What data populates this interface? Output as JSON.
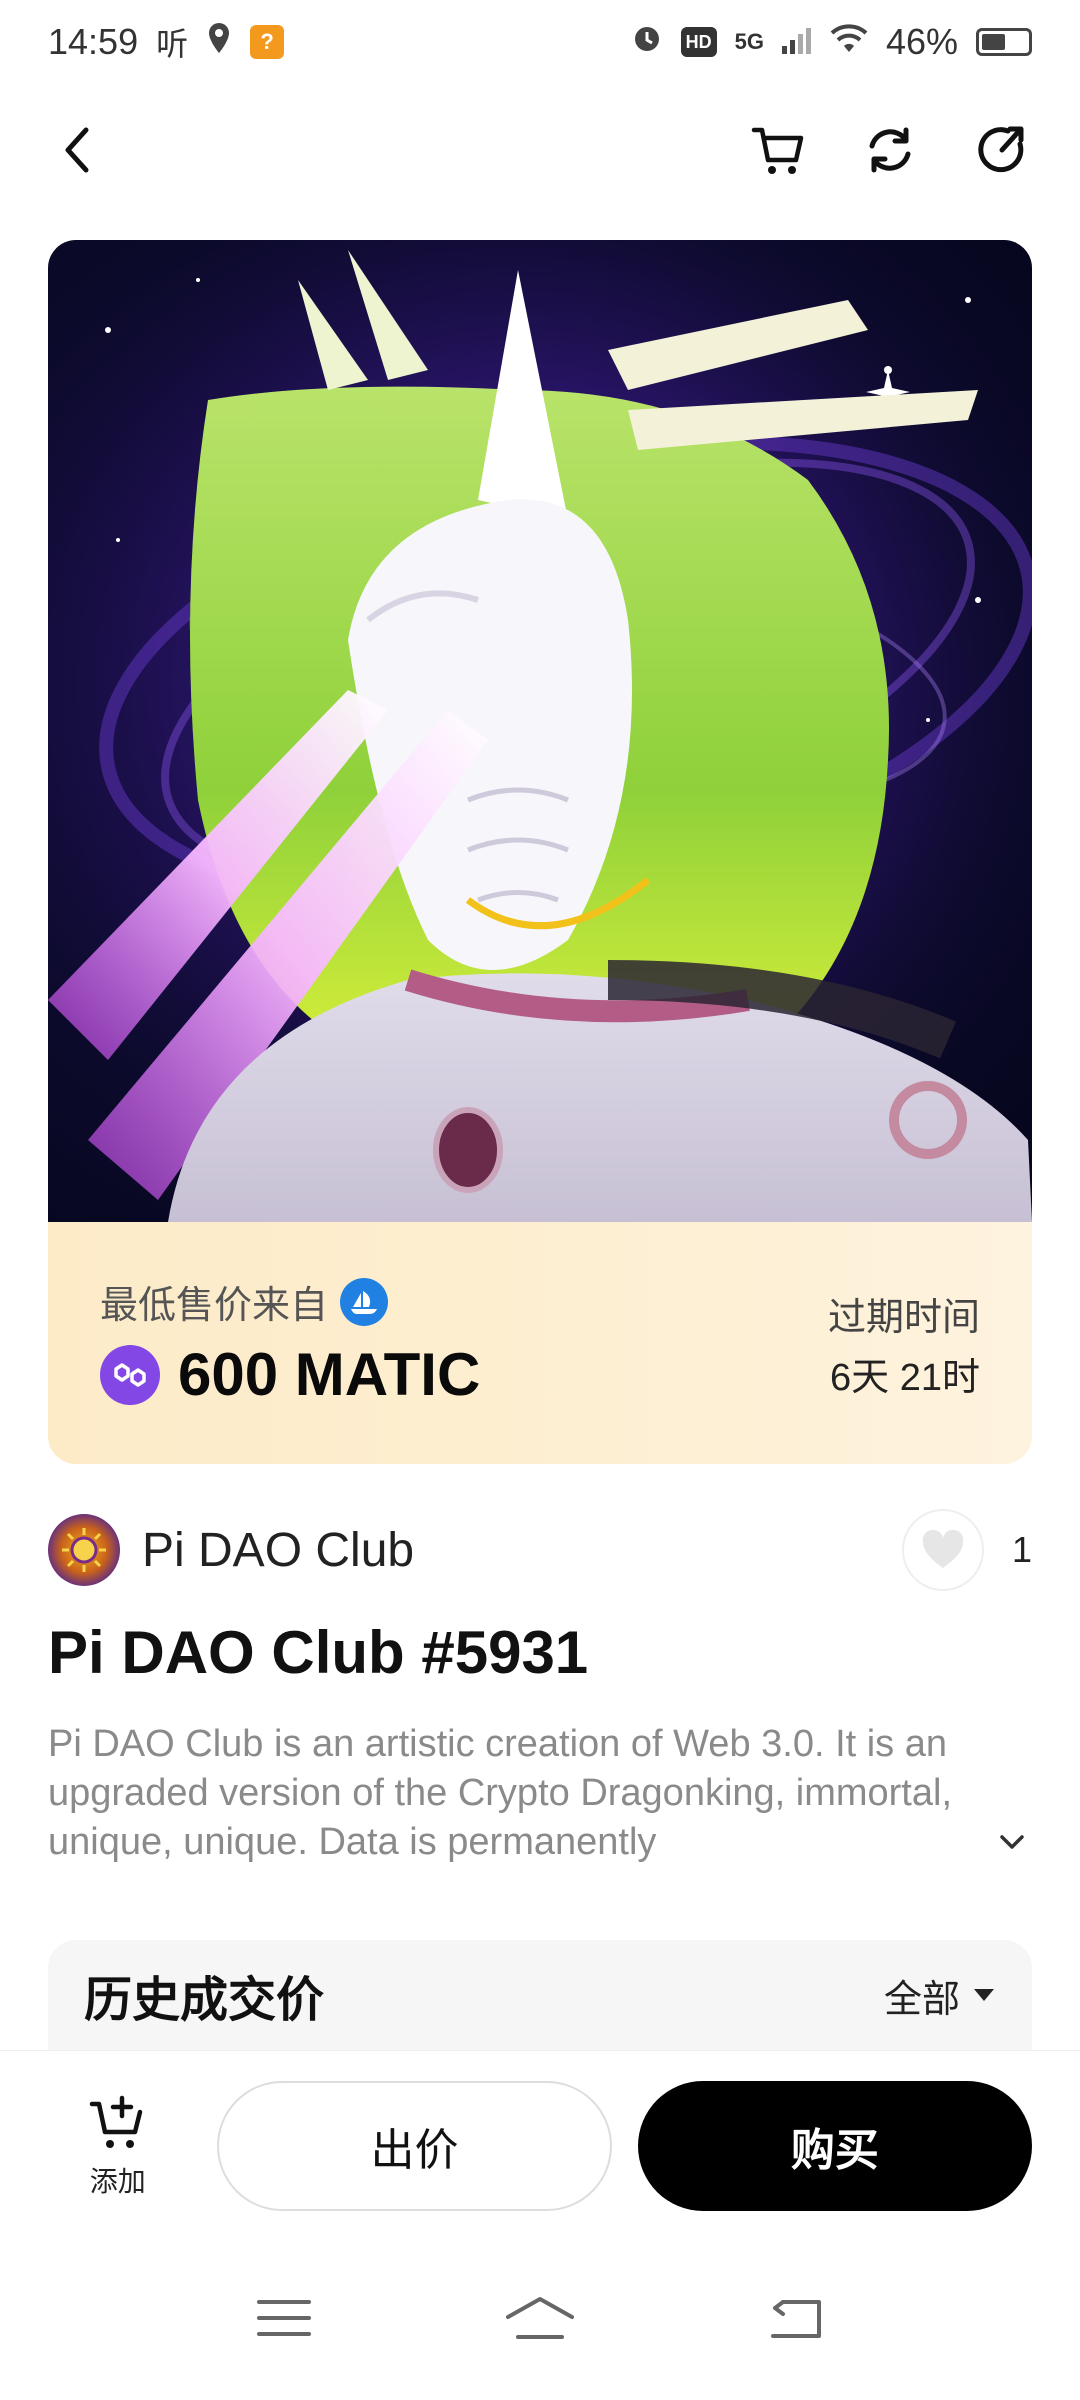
{
  "status_bar": {
    "time": "14:59",
    "listen": "听",
    "network": "5G",
    "battery": "46%"
  },
  "price": {
    "label": "最低售价来自",
    "amount": "600 MATIC",
    "expiry_label": "过期时间",
    "expiry_value": "6天 21时"
  },
  "collection": {
    "name": "Pi DAO Club",
    "likes": "1"
  },
  "nft": {
    "title": "Pi DAO Club #5931",
    "description": "Pi DAO Club is an artistic creation of Web 3.0. It is an upgraded version of the Crypto Dragonking, immortal, unique, unique. Data is permanently"
  },
  "history": {
    "title": "历史成交价",
    "filter": "全部"
  },
  "bottom_bar": {
    "add_label": "添加",
    "bid_label": "出价",
    "buy_label": "购买"
  },
  "colors": {
    "matic": "#8247e5",
    "opensea": "#2081e2",
    "price_card": "#fdebc8"
  }
}
